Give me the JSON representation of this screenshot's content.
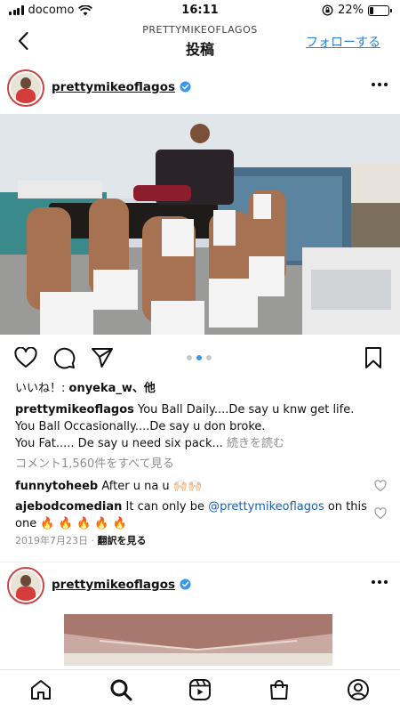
{
  "status_bar": {
    "carrier": "docomo",
    "time": "16:11",
    "battery": "22%",
    "battery_level": 0.22
  },
  "nav": {
    "subtitle": "PRETTYMIKEOFLAGOS",
    "title": "投稿",
    "follow": "フォローする"
  },
  "post": {
    "username": "prettymikeoflagos",
    "likes_prefix": "いいね！: ",
    "likes_user": "onyeka_w",
    "likes_suffix": "、他",
    "caption_user": "prettymikeoflagos",
    "caption_line1": " You Ball Daily....De say u knw get life.",
    "caption_line2": "You Ball Occasionally....De say u don broke.",
    "caption_line3": "You Fat..... De say u need six pack...",
    "more": " 続きを読む",
    "view_comments": "コメント1,560件をすべて見る",
    "comments": [
      {
        "user": "funnytoheeb",
        "text": " After u na u 🙌🏻🙌🏻"
      },
      {
        "user": "ajebodcomedian",
        "text": " It can only be ",
        "mention": "@prettymikeoflagos",
        "text2": " on this",
        "line2": "one 🔥 🔥 🔥 🔥 🔥"
      }
    ],
    "date": "2019年7月23日",
    "separator": " · ",
    "translate": "翻訳を見る",
    "carousel": {
      "count": 3,
      "active": 1
    }
  },
  "post2": {
    "username": "prettymikeoflagos"
  },
  "icons": {
    "back": "chevron-left-icon",
    "verified": "verified-badge-icon",
    "more": "more-icon",
    "like": "heart-icon",
    "comment": "comment-icon",
    "share": "send-icon",
    "save": "bookmark-icon",
    "tabs": [
      "home-icon",
      "search-icon",
      "reels-icon",
      "shop-icon",
      "profile-icon"
    ]
  },
  "colors": {
    "link": "#2f7fd6",
    "mention": "#1a5fb4",
    "verified": "#3897f0",
    "carousel_active": "#3897f0",
    "muted": "#8e8e8e"
  }
}
